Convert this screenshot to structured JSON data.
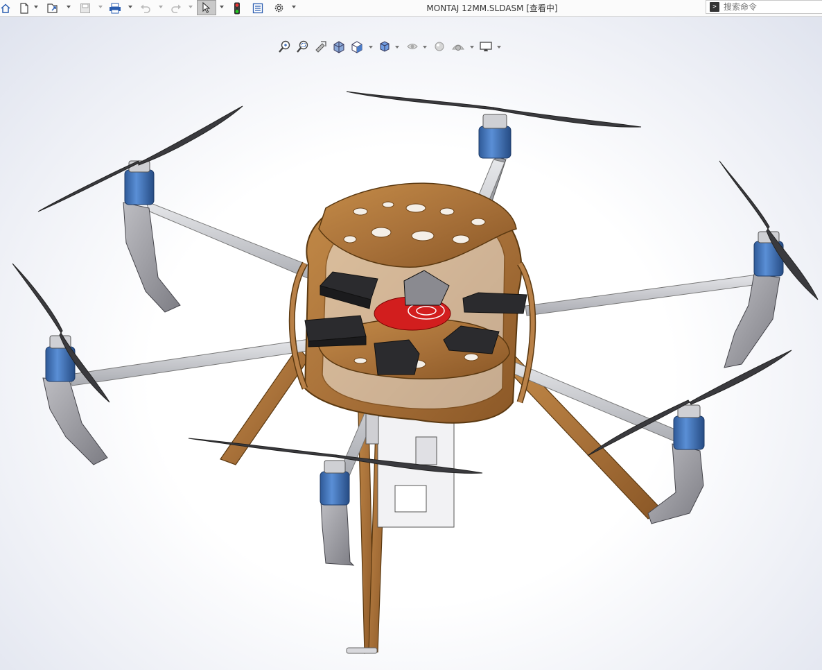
{
  "window": {
    "title": "MONTAJ 12MM.SLDASM [查看中]"
  },
  "search": {
    "placeholder": "搜索命令"
  },
  "toolbar": {
    "buttons": [
      "home-icon",
      "new-document-icon",
      "open-icon",
      "save-icon",
      "print-icon",
      "undo-icon",
      "redo-icon",
      "select-icon",
      "rebuild-icon",
      "file-properties-icon",
      "options-gear-icon"
    ]
  },
  "heads_up_toolbar": {
    "buttons": [
      "zoom-to-fit-icon",
      "zoom-to-area-icon",
      "previous-view-icon",
      "section-view-icon",
      "view-orientation-icon",
      "display-style-icon",
      "hide-show-items-icon",
      "edit-appearance-icon",
      "apply-scene-icon",
      "view-settings-icon"
    ]
  },
  "model": {
    "name": "hexacopter drone assembly",
    "colors": {
      "wood": "#b07a3c",
      "wood_dark": "#6e4418",
      "arm": "#c9cbcf",
      "motor_blue": "#3d6fb0",
      "propeller": "#3a3a3e",
      "battery": "#2b2b2e",
      "board_red": "#d21e1e",
      "gimbal_blue": "#1a5ae0",
      "landing_gear": "#9a9aa0"
    }
  }
}
